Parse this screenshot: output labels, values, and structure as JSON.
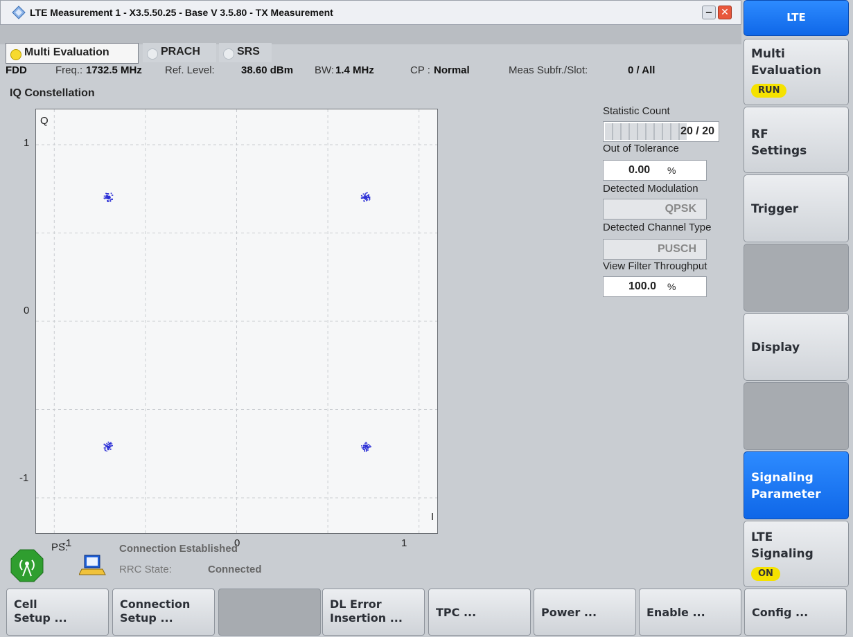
{
  "window": {
    "title": "LTE Measurement 1 - X3.5.50.25 - Base V 3.5.80 - TX Measurement",
    "minimize_glyph": "‒",
    "close_glyph": "✕"
  },
  "tabs": [
    {
      "label": "Multi Evaluation",
      "active": true
    },
    {
      "label": "PRACH",
      "active": false
    },
    {
      "label": "SRS",
      "active": false
    }
  ],
  "info": {
    "duplex": "FDD",
    "freq_label": "Freq.:",
    "freq_value": "1732.5 MHz",
    "ref_label": "Ref. Level:",
    "ref_value": "38.60 dBm",
    "bw_label": "BW:",
    "bw_value": "1.4 MHz",
    "cp_label": "CP :",
    "cp_value": "Normal",
    "subfr_label": "Meas Subfr./Slot:",
    "subfr_value": "0  / All"
  },
  "section_title": "IQ Constellation",
  "chart_data": {
    "type": "scatter",
    "xlabel": "I",
    "ylabel": "Q",
    "xlim": [
      -1.1,
      1.1
    ],
    "ylim": [
      -1.2,
      1.2
    ],
    "xticks": [
      -1,
      0,
      1
    ],
    "yticks": [
      1,
      0,
      -1
    ],
    "grid": true,
    "series": [
      {
        "color": "#2b2fd6",
        "points": [
          [
            -0.707,
            0.707
          ],
          [
            0.707,
            0.707
          ],
          [
            -0.707,
            -0.707
          ],
          [
            0.707,
            -0.707
          ]
        ]
      }
    ]
  },
  "stats": {
    "count_label": "Statistic Count",
    "count_value": "20 / 20",
    "count_progress": 1.0,
    "tol_label": "Out of Tolerance",
    "tol_value": "0.00",
    "tol_unit": "%",
    "mod_label": "Detected Modulation",
    "mod_value": "QPSK",
    "chan_label": "Detected Channel Type",
    "chan_value": "PUSCH",
    "filter_label": "View Filter Throughput",
    "filter_value": "100.0",
    "filter_unit": "%"
  },
  "right_keys": {
    "top": "LTE",
    "multi_eval_line1": "Multi",
    "multi_eval_line2": "Evaluation",
    "multi_eval_state": "RUN",
    "rf_line1": "RF",
    "rf_line2": "Settings",
    "trigger": "Trigger",
    "display": "Display",
    "sig_line1": "Signaling",
    "sig_line2": "Parameter",
    "lte_sig_line1": "LTE",
    "lte_sig_line2": "Signaling",
    "lte_sig_state": "ON"
  },
  "status": {
    "ps_label": "PS:",
    "connection": "Connection Established",
    "rrc_label": "RRC State:",
    "rrc_value": "Connected"
  },
  "bottom_keys": [
    {
      "l1": "Cell",
      "l2": "Setup ..."
    },
    {
      "l1": "Connection",
      "l2": "Setup ..."
    },
    {
      "l1": "",
      "l2": ""
    },
    {
      "l1": "DL Error",
      "l2": "Insertion ..."
    },
    {
      "l1": "TPC ...",
      "l2": ""
    },
    {
      "l1": "Power ...",
      "l2": ""
    },
    {
      "l1": "Enable ...",
      "l2": ""
    },
    {
      "l1": "Config ...",
      "l2": ""
    }
  ],
  "colors": {
    "accent_blue": "#1473f0",
    "run_yellow": "#f5e200",
    "constellation_points": "#2b2fd6"
  },
  "icons": {
    "app": "rohde-schwarz-diamond-icon",
    "antenna": "antenna-signal-icon",
    "ue": "computer-terminal-icon"
  }
}
